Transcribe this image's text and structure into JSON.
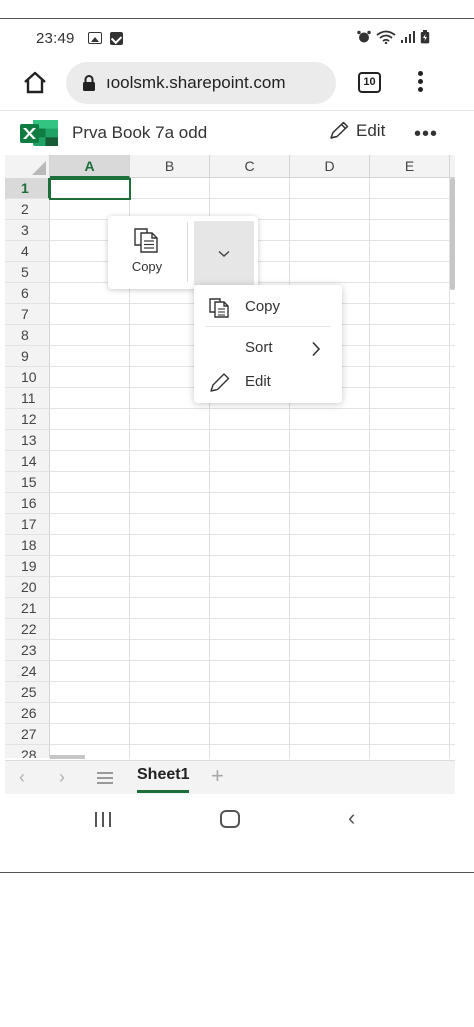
{
  "status_bar": {
    "time": "23:49"
  },
  "browser": {
    "url": "ıoolsmk.sharepoint.com",
    "tab_count": "10"
  },
  "excel": {
    "doc_title": "Prva Book 7a odd",
    "edit_label": "Edit",
    "more_label": "•••",
    "brand_color": "#1e6e3a"
  },
  "grid": {
    "columns": [
      "A",
      "B",
      "C",
      "D",
      "E"
    ],
    "rows": [
      "1",
      "2",
      "3",
      "4",
      "5",
      "6",
      "7",
      "8",
      "9",
      "10",
      "11",
      "12",
      "13",
      "14",
      "15",
      "16",
      "17",
      "18",
      "19",
      "20",
      "21",
      "22",
      "23",
      "24",
      "25",
      "26",
      "27",
      "28"
    ],
    "selected_cell": "A1"
  },
  "copy_toolbar": {
    "copy_label": "Copy"
  },
  "context_menu": {
    "copy_label": "Copy",
    "sort_label": "Sort",
    "edit_label": "Edit"
  },
  "sheet_tabs": {
    "active_sheet": "Sheet1"
  }
}
